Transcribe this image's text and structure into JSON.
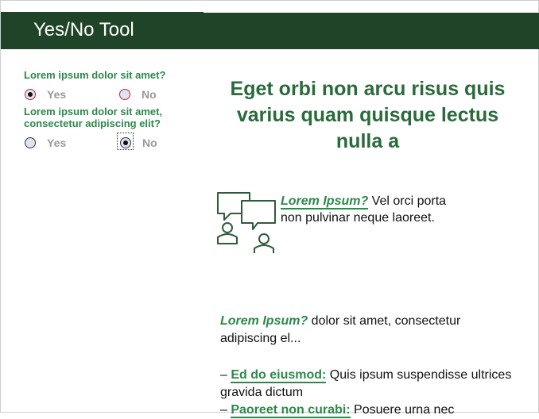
{
  "header": {
    "title": "Yes/No Tool"
  },
  "survey": {
    "questions": [
      {
        "text": "Lorem ipsum dolor sit amet?",
        "yes_label": "Yes",
        "no_label": "No",
        "selected": "Yes"
      },
      {
        "text": "Lorem ipsum dolor sit amet, consectetur adipiscing elit?",
        "yes_label": "Yes",
        "no_label": "No",
        "selected": "No"
      }
    ]
  },
  "main": {
    "heading": "Eget orbi non arcu risus quis varius quam quisque lectus nulla a",
    "card": {
      "lead": "Lorem Ipsum?",
      "text": " Vel orci porta non pulvinar neque laoreet."
    },
    "para1": {
      "lead": "Lorem Ipsum?",
      "text": " dolor sit amet, consectetur adipiscing el..."
    },
    "list": [
      {
        "dash": "– ",
        "link": "Ed do eiusmod:",
        "text": " Quis ipsum suspendisse ultrices gravida dictum"
      },
      {
        "dash": "– ",
        "link": "Paoreet non curabi:",
        "text": " Posuere urna nec"
      }
    ]
  },
  "icons": {
    "chat": "conversation-people-icon"
  },
  "colors": {
    "header_bg": "#1f4427",
    "accent_green": "#2b8a4a",
    "heading_green": "#2a6b3c"
  }
}
